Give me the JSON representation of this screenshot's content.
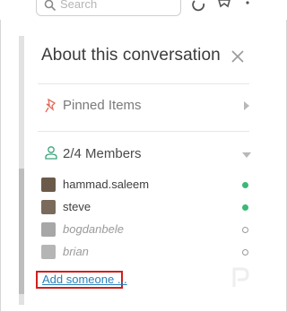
{
  "search": {
    "placeholder": "Search"
  },
  "panel": {
    "title": "About this conversation"
  },
  "sections": {
    "pinned": {
      "label": "Pinned Items"
    },
    "members": {
      "label": "2/4 Members"
    }
  },
  "members": [
    {
      "name": "hammad.saleem",
      "status": "active",
      "avatar_color": "#6b5a4a"
    },
    {
      "name": "steve",
      "status": "active",
      "avatar_color": "#7a6a5c"
    },
    {
      "name": "bogdanbele",
      "status": "away",
      "avatar_color": "#a7a7a7"
    },
    {
      "name": "brian",
      "status": "away",
      "avatar_color": "#b5b5b5"
    }
  ],
  "add_link": {
    "label": "Add someone ..."
  },
  "colors": {
    "active_presence": "#3cb878",
    "link": "#2a80b9",
    "highlight_box": "#d0201c",
    "pin_icon": "#e26a5c",
    "members_icon": "#3aa57a"
  },
  "icons": [
    "search-icon",
    "history-icon",
    "star-icon",
    "close-icon",
    "pin-icon",
    "person-icon",
    "chevron-right-icon",
    "chevron-down-icon"
  ]
}
